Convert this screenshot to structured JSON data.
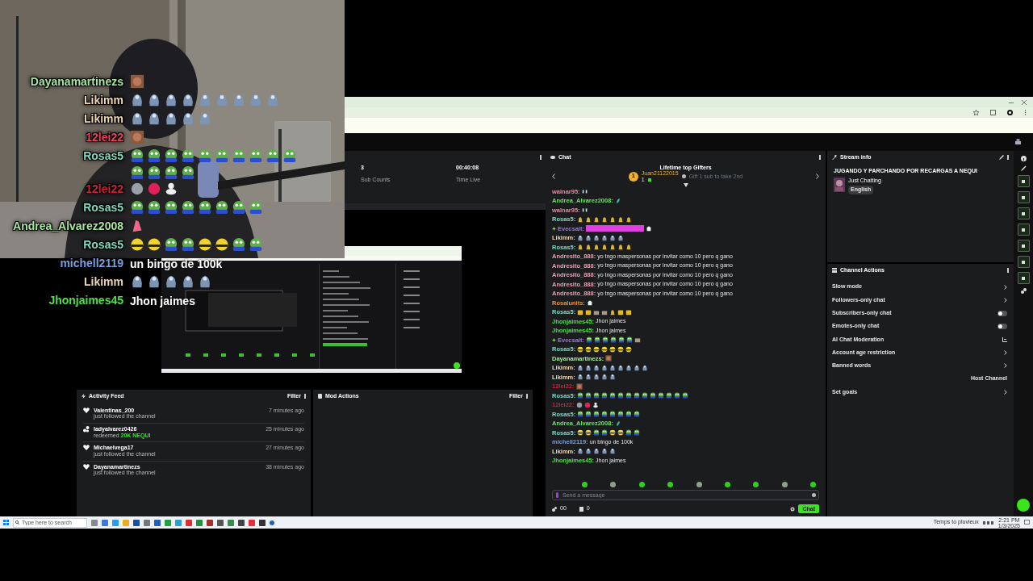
{
  "overlay_chat": [
    {
      "user": "Dayanamartinezs",
      "color": "#a8e6a0",
      "emotes": [
        {
          "kind": "face"
        }
      ]
    },
    {
      "user": "Likimm",
      "color": "#f0d6b0",
      "emotes": [
        {
          "kind": "seal"
        },
        {
          "kind": "seal"
        },
        {
          "kind": "seal"
        },
        {
          "kind": "seal"
        },
        {
          "kind": "seal"
        },
        {
          "kind": "seal"
        },
        {
          "kind": "seal"
        },
        {
          "kind": "seal"
        },
        {
          "kind": "seal"
        }
      ]
    },
    {
      "user": "Likimm",
      "color": "#f0d6b0",
      "emotes": [
        {
          "kind": "seal"
        },
        {
          "kind": "seal"
        },
        {
          "kind": "seal"
        },
        {
          "kind": "seal"
        },
        {
          "kind": "seal"
        }
      ]
    },
    {
      "user": "12lei22",
      "color": "#f2405a",
      "emotes": [
        {
          "kind": "face"
        }
      ]
    },
    {
      "user": "Rosas5",
      "color": "#7fd8c0",
      "emotes": [
        {
          "kind": "frog"
        },
        {
          "kind": "frog"
        },
        {
          "kind": "frog"
        },
        {
          "kind": "frog"
        },
        {
          "kind": "frog"
        },
        {
          "kind": "frog"
        },
        {
          "kind": "frog"
        },
        {
          "kind": "frog"
        },
        {
          "kind": "frog"
        },
        {
          "kind": "frog"
        },
        {
          "kind": "frog"
        },
        {
          "kind": "frog"
        },
        {
          "kind": "frog"
        },
        {
          "kind": "frog"
        }
      ]
    },
    {
      "user": "12lei22",
      "color": "#d0203a",
      "emotes": [
        {
          "kind": "glass"
        },
        {
          "kind": "orb"
        },
        {
          "kind": "duck"
        }
      ]
    },
    {
      "user": "Rosas5",
      "color": "#7fd8c0",
      "emotes": [
        {
          "kind": "frog"
        },
        {
          "kind": "frog"
        },
        {
          "kind": "frog"
        },
        {
          "kind": "frog"
        },
        {
          "kind": "frog"
        },
        {
          "kind": "frog"
        },
        {
          "kind": "frog"
        },
        {
          "kind": "frog"
        }
      ]
    },
    {
      "user": "Andrea_Alvarez2008",
      "color": "#a8e6a0",
      "emotes": [
        {
          "kind": "pink"
        }
      ]
    },
    {
      "user": "Rosas5",
      "color": "#7fd8c0",
      "emotes": [
        {
          "kind": "bee"
        },
        {
          "kind": "bee"
        },
        {
          "kind": "frog"
        },
        {
          "kind": "frog"
        },
        {
          "kind": "bee"
        },
        {
          "kind": "bee"
        },
        {
          "kind": "frog"
        },
        {
          "kind": "frog"
        }
      ]
    },
    {
      "user": "michell2119",
      "color": "#7a9ee0",
      "text": "un bingo de 100k"
    },
    {
      "user": "Likimm",
      "color": "#f0d6b0",
      "emotes": [
        {
          "kind": "seal"
        },
        {
          "kind": "seal"
        },
        {
          "kind": "seal"
        },
        {
          "kind": "seal"
        },
        {
          "kind": "seal"
        }
      ]
    },
    {
      "user": "Jhonjaimes45",
      "color": "#4fe04a",
      "text": "Jhon jaimes"
    }
  ],
  "stats": [
    {
      "value": "3",
      "label": "Sub Counts"
    },
    {
      "value": "00:40:08",
      "label": "Time Live"
    }
  ],
  "activity_feed": {
    "title": "Activity Feed",
    "filter": "Filter",
    "items": [
      {
        "kind": "follow",
        "user": "Valentinas_200",
        "detail": "just followed the channel",
        "time": "7 minutes ago"
      },
      {
        "kind": "redeem",
        "user": "ladyalvarez0426",
        "detail": "redeemed",
        "reward": "20K NEQUI",
        "time": "25 minutes ago"
      },
      {
        "kind": "follow",
        "user": "Michaelvega17",
        "detail": "just followed the channel",
        "time": "27 minutes ago"
      },
      {
        "kind": "follow",
        "user": "Dayanamartinezs",
        "detail": "just followed the channel",
        "time": "38 minutes ago"
      }
    ]
  },
  "mod_actions": {
    "title": "Mod Actions",
    "filter": "Filter"
  },
  "chat": {
    "title": "Chat",
    "gifters_title": "Lifetime top Gifters",
    "gifter": {
      "rank": "1",
      "name": "Juan21122015",
      "count": "1"
    },
    "gift_hint": "Gift 1 sub to take 2nd",
    "messages": [
      {
        "user": "walnar95:",
        "color": "#e08aa0",
        "emotes": [
          {
            "kind": "tiny"
          }
        ]
      },
      {
        "user": "Andrea_Alvarez2008:",
        "color": "#6fe06a",
        "emotes": [
          {
            "kind": "teal"
          }
        ]
      },
      {
        "user": "walnar95:",
        "color": "#e08aa0",
        "emotes": [
          {
            "kind": "tiny"
          }
        ]
      },
      {
        "user": "Rosas5:",
        "color": "#7fd8c0",
        "emotes": [
          {
            "kind": "bell"
          },
          {
            "kind": "bell"
          },
          {
            "kind": "bell"
          },
          {
            "kind": "bell"
          },
          {
            "kind": "bell"
          },
          {
            "kind": "bell"
          },
          {
            "kind": "bell"
          }
        ]
      },
      {
        "user": "Evecsalt:",
        "color": "#a070f0",
        "badge": true,
        "emotes": [
          {
            "kind": "pinkbar"
          },
          {
            "kind": "ghost"
          }
        ]
      },
      {
        "user": "Likimm:",
        "color": "#f0d6b0",
        "emotes": [
          {
            "kind": "seal"
          },
          {
            "kind": "seal"
          },
          {
            "kind": "seal"
          },
          {
            "kind": "seal"
          },
          {
            "kind": "seal"
          },
          {
            "kind": "seal"
          }
        ]
      },
      {
        "user": "Rosas5:",
        "color": "#7fd8c0",
        "emotes": [
          {
            "kind": "bell"
          },
          {
            "kind": "bell"
          },
          {
            "kind": "bell"
          },
          {
            "kind": "bell"
          },
          {
            "kind": "bell"
          },
          {
            "kind": "bell"
          },
          {
            "kind": "bell"
          }
        ]
      },
      {
        "user": "Andresito_888:",
        "color": "#e0a0b0",
        "text": "yo tngo maspersonas por invitar como 10 pero q gano"
      },
      {
        "user": "Andresito_888:",
        "color": "#e0a0b0",
        "text": "yo tngo maspersonas por invitar como 10 pero q gano"
      },
      {
        "user": "Andresito_888:",
        "color": "#e0a0b0",
        "text": "yo tngo maspersonas por invitar como 10 pero q gano"
      },
      {
        "user": "Andresito_888:",
        "color": "#e0a0b0",
        "text": "yo tngo maspersonas por invitar como 10 pero q gano"
      },
      {
        "user": "Andresito_888:",
        "color": "#e0a0b0",
        "text": "yo tngo maspersonas por invitar como 10 pero q gano"
      },
      {
        "user": "Rosalunits:",
        "color": "#f09030",
        "emotes": [
          {
            "kind": "ghost"
          }
        ]
      },
      {
        "user": "Rosas5:",
        "color": "#7fd8c0",
        "emotes": [
          {
            "kind": "cheese"
          },
          {
            "kind": "cheese"
          },
          {
            "kind": "stack"
          },
          {
            "kind": "stack"
          },
          {
            "kind": "bell"
          },
          {
            "kind": "cheese"
          },
          {
            "kind": "cheese"
          }
        ]
      },
      {
        "user": "Jhonjaimes45:",
        "color": "#4fe04a",
        "text": "Jhon jaimes"
      },
      {
        "user": "Jhonjaimes45:",
        "color": "#4fe04a",
        "text": "Jhon jaimes"
      },
      {
        "user": "Evecsalt:",
        "color": "#a070f0",
        "badge": true,
        "emotes": [
          {
            "kind": "frog"
          },
          {
            "kind": "frog"
          },
          {
            "kind": "frog"
          },
          {
            "kind": "frog"
          },
          {
            "kind": "frog"
          },
          {
            "kind": "frog"
          },
          {
            "kind": "stack"
          }
        ]
      },
      {
        "user": "Rosas5:",
        "color": "#7fd8c0",
        "emotes": [
          {
            "kind": "bee"
          },
          {
            "kind": "bee"
          },
          {
            "kind": "bee"
          },
          {
            "kind": "bee"
          },
          {
            "kind": "bee"
          },
          {
            "kind": "bee"
          },
          {
            "kind": "bee"
          }
        ]
      },
      {
        "user": "Dayanamartinezs:",
        "color": "#a8e6a0",
        "emotes": [
          {
            "kind": "face"
          }
        ]
      },
      {
        "user": "Likimm:",
        "color": "#f0d6b0",
        "emotes": [
          {
            "kind": "seal"
          },
          {
            "kind": "seal"
          },
          {
            "kind": "seal"
          },
          {
            "kind": "seal"
          },
          {
            "kind": "seal"
          },
          {
            "kind": "seal"
          },
          {
            "kind": "seal"
          },
          {
            "kind": "seal"
          },
          {
            "kind": "seal"
          }
        ]
      },
      {
        "user": "Likimm:",
        "color": "#f0d6b0",
        "emotes": [
          {
            "kind": "seal"
          },
          {
            "kind": "seal"
          },
          {
            "kind": "seal"
          },
          {
            "kind": "seal"
          },
          {
            "kind": "seal"
          }
        ]
      },
      {
        "user": "12lei22:",
        "color": "#d0203a",
        "emotes": [
          {
            "kind": "face"
          }
        ]
      },
      {
        "user": "Rosas5:",
        "color": "#7fd8c0",
        "emotes": [
          {
            "kind": "frog"
          },
          {
            "kind": "frog"
          },
          {
            "kind": "frog"
          },
          {
            "kind": "frog"
          },
          {
            "kind": "frog"
          },
          {
            "kind": "frog"
          },
          {
            "kind": "frog"
          },
          {
            "kind": "frog"
          },
          {
            "kind": "frog"
          },
          {
            "kind": "frog"
          },
          {
            "kind": "frog"
          },
          {
            "kind": "frog"
          },
          {
            "kind": "frog"
          },
          {
            "kind": "frog"
          }
        ]
      },
      {
        "user": "12lei22:",
        "color": "#d0203a",
        "emotes": [
          {
            "kind": "glass"
          },
          {
            "kind": "orb"
          },
          {
            "kind": "duck"
          }
        ]
      },
      {
        "user": "Rosas5:",
        "color": "#7fd8c0",
        "emotes": [
          {
            "kind": "frog"
          },
          {
            "kind": "frog"
          },
          {
            "kind": "frog"
          },
          {
            "kind": "frog"
          },
          {
            "kind": "frog"
          },
          {
            "kind": "frog"
          },
          {
            "kind": "frog"
          },
          {
            "kind": "frog"
          }
        ]
      },
      {
        "user": "Andrea_Alvarez2008:",
        "color": "#6fe06a",
        "emotes": [
          {
            "kind": "teal"
          }
        ]
      },
      {
        "user": "Rosas5:",
        "color": "#7fd8c0",
        "emotes": [
          {
            "kind": "bee"
          },
          {
            "kind": "bee"
          },
          {
            "kind": "frog"
          },
          {
            "kind": "frog"
          },
          {
            "kind": "bee"
          },
          {
            "kind": "bee"
          },
          {
            "kind": "frog"
          },
          {
            "kind": "frog"
          }
        ]
      },
      {
        "user": "michell2119:",
        "color": "#7a9ee0",
        "text": "un bingo de 100k"
      },
      {
        "user": "Likimm:",
        "color": "#f0d6b0",
        "emotes": [
          {
            "kind": "seal"
          },
          {
            "kind": "seal"
          },
          {
            "kind": "seal"
          },
          {
            "kind": "seal"
          },
          {
            "kind": "seal"
          }
        ]
      },
      {
        "user": "Jhonjaimes45:",
        "color": "#4fe04a",
        "text": "Jhon jaimes"
      }
    ],
    "input": {
      "placeholder": "Send a message"
    },
    "points": "00",
    "bits": "0",
    "send": "Chat"
  },
  "stream_info": {
    "title": "Stream info",
    "stream_title": "JUGANDO Y PARCHANDO POR RECARGAS A NEQUI",
    "category": "Just Chatting",
    "tag": "English"
  },
  "channel_actions": {
    "title": "Channel Actions",
    "items": [
      {
        "kind": "arrow",
        "label": "Slow mode"
      },
      {
        "kind": "arrow",
        "label": "Followers-only chat"
      },
      {
        "kind": "toggle",
        "label": "Subscribers-only chat",
        "on": false
      },
      {
        "kind": "toggle",
        "label": "Emotes-only chat",
        "on": false
      },
      {
        "kind": "icon",
        "label": "AI Chat Moderation"
      },
      {
        "kind": "arrow",
        "label": "Account age restriction"
      },
      {
        "kind": "arrow",
        "label": "Banned words"
      },
      {
        "kind": "plain",
        "label": "Host Channel"
      },
      {
        "kind": "arrow",
        "label": "Set goals"
      }
    ]
  },
  "taskbar": {
    "search_placeholder": "Type here to search",
    "weather": "Temps to pluvieux",
    "time": "2:21 PM",
    "date": "1/3/2025"
  }
}
